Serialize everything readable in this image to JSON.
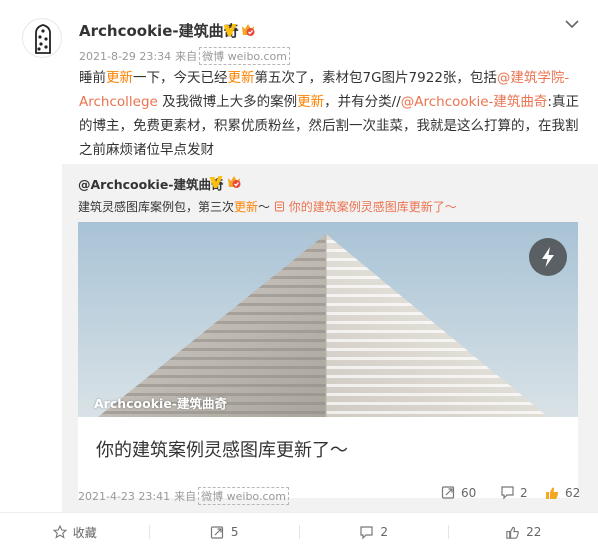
{
  "post": {
    "author": "Archcookie-建筑曲奇",
    "time": "2021-8-29 23:34",
    "from_label": "来自",
    "source": "微博 weibo.com",
    "text": [
      {
        "t": "睡前",
        "k": "n"
      },
      {
        "t": "更新",
        "k": "hl"
      },
      {
        "t": "一下，今天已经",
        "k": "n"
      },
      {
        "t": "更新",
        "k": "hl"
      },
      {
        "t": "第五次了，素材包7G图片7922张，包括",
        "k": "n"
      },
      {
        "t": "@建筑学院-Archcollege",
        "k": "lk"
      },
      {
        "t": " 及我微博上大多的案例",
        "k": "n"
      },
      {
        "t": "更新",
        "k": "hl"
      },
      {
        "t": "，并有分类//",
        "k": "n"
      },
      {
        "t": "@Archcookie-建筑曲奇",
        "k": "lk"
      },
      {
        "t": ":真正的博主，免费更素材，积累优质粉丝，然后割一次韭菜，我就是这么打算的，在我割之前麻烦诸位早点发财",
        "k": "n"
      }
    ]
  },
  "repost": {
    "author": "@Archcookie-建筑曲奇",
    "text_before": "建筑灵感图库案例包，第三次",
    "text_hl": "更新",
    "text_after": "～ ",
    "link_text": "你的建筑案例灵感图库更新了～",
    "watermark": "Archcookie-建筑曲奇",
    "media_title": "你的建筑案例灵感图库更新了～",
    "time": "2021-4-23 23:41",
    "from_label": "来自",
    "source": "微博 weibo.com",
    "reposts": "60",
    "comments": "2",
    "likes": "62"
  },
  "actions": {
    "favorite": "收藏",
    "repost": "5",
    "comment": "2",
    "like": "22"
  },
  "colors": {
    "highlight": "#ff8200",
    "link": "#eb7350",
    "verified": "#ffc107",
    "repost_bg": "#f2f2f2"
  },
  "icons": [
    "avatar-cookie-icon",
    "chevron-down-icon",
    "verified-v-icon",
    "vip-badge-icon",
    "link-icon",
    "flash-icon",
    "repost-icon",
    "comment-icon",
    "like-icon",
    "star-icon"
  ]
}
